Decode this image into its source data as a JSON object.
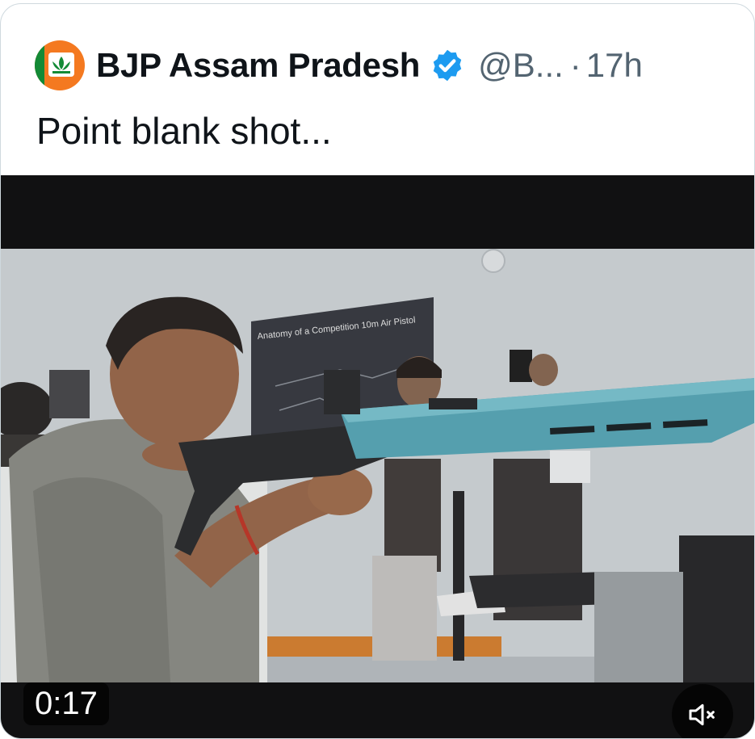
{
  "tweet": {
    "display_name": "BJP Assam Pradesh",
    "handle": "@B...",
    "separator": "·",
    "time": "17h",
    "text": "Point blank shot...",
    "verified": true
  },
  "video": {
    "board_title": "Anatomy of a Competition 10m Air Pistol",
    "duration": "0:17",
    "muted": true
  },
  "icons": {
    "avatar": "bjp-lotus-logo",
    "verified": "verified-badge-icon",
    "mute": "speaker-muted-icon"
  },
  "colors": {
    "verified_blue": "#1d9bf0",
    "avatar_orange": "#f47920",
    "text": "#0f1419",
    "secondary": "#536471"
  }
}
